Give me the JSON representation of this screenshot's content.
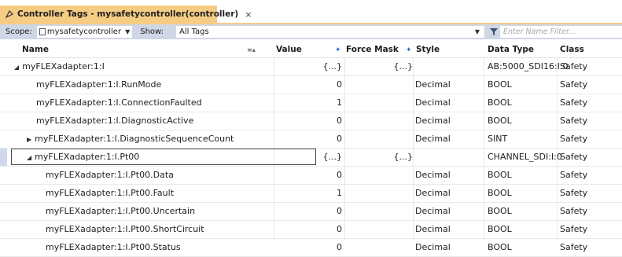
{
  "tab": {
    "title": "Controller Tags - mysafetycontroller(controller)",
    "close": "×"
  },
  "filter": {
    "scope_label": "Scope:",
    "scope_value": "mysafetycontroller",
    "show_label": "Show:",
    "show_value": "All Tags",
    "name_filter_placeholder": "Enter Name Filter..."
  },
  "columns": {
    "name": "Name",
    "value": "Value",
    "force_mask": "Force Mask",
    "style": "Style",
    "data_type": "Data Type",
    "class": "Class"
  },
  "rows": [
    {
      "name": "myFLEXadapter:1:I",
      "value": "{...}",
      "force": "{...}",
      "style": "",
      "type": "AB:5000_SDI16:I:0",
      "class": "Safety",
      "expander": "expanded",
      "indent": 0
    },
    {
      "name": "myFLEXadapter:1:I.RunMode",
      "value": "0",
      "force": "",
      "style": "Decimal",
      "type": "BOOL",
      "class": "Safety",
      "expander": "none",
      "indent": 1
    },
    {
      "name": "myFLEXadapter:1:I.ConnectionFaulted",
      "value": "1",
      "force": "",
      "style": "Decimal",
      "type": "BOOL",
      "class": "Safety",
      "expander": "none",
      "indent": 1
    },
    {
      "name": "myFLEXadapter:1:I.DiagnosticActive",
      "value": "0",
      "force": "",
      "style": "Decimal",
      "type": "BOOL",
      "class": "Safety",
      "expander": "none",
      "indent": 1
    },
    {
      "name": "myFLEXadapter:1:I.DiagnosticSequenceCount",
      "value": "0",
      "force": "",
      "style": "Decimal",
      "type": "SINT",
      "class": "Safety",
      "expander": "collapsed",
      "indent": 1
    },
    {
      "name": "myFLEXadapter:1:I.Pt00",
      "value": "{...}",
      "force": "{...}",
      "style": "",
      "type": "CHANNEL_SDI:I:0",
      "class": "Safety",
      "expander": "expanded",
      "indent": 1,
      "selected": true
    },
    {
      "name": "myFLEXadapter:1:I.Pt00.Data",
      "value": "0",
      "force": "",
      "style": "Decimal",
      "type": "BOOL",
      "class": "Safety",
      "expander": "none",
      "indent": 2
    },
    {
      "name": "myFLEXadapter:1:I.Pt00.Fault",
      "value": "1",
      "force": "",
      "style": "Decimal",
      "type": "BOOL",
      "class": "Safety",
      "expander": "none",
      "indent": 2
    },
    {
      "name": "myFLEXadapter:1:I.Pt00.Uncertain",
      "value": "0",
      "force": "",
      "style": "Decimal",
      "type": "BOOL",
      "class": "Safety",
      "expander": "none",
      "indent": 2
    },
    {
      "name": "myFLEXadapter:1:I.Pt00.ShortCircuit",
      "value": "0",
      "force": "",
      "style": "Decimal",
      "type": "BOOL",
      "class": "Safety",
      "expander": "none",
      "indent": 2
    },
    {
      "name": "myFLEXadapter:1:I.Pt00.Status",
      "value": "0",
      "force": "",
      "style": "Decimal",
      "type": "BOOL",
      "class": "Safety",
      "expander": "none",
      "indent": 2
    }
  ],
  "icons": {
    "tab": "safety-tag-icon",
    "scope": "controller-icon",
    "filter": "filter-icon",
    "dropdown": "chevron-down-icon"
  },
  "colors": {
    "tab_active": "#f5cc84",
    "filterbar": "#cfd6e5",
    "selection": "#cfd8ec",
    "sort_marker": "#2a6bcf"
  }
}
